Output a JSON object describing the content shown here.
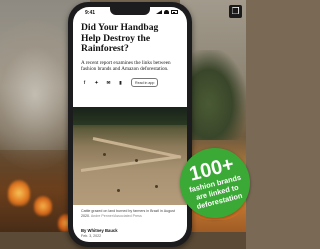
{
  "phone": {
    "status_time": "9:41",
    "article": {
      "headline": "Did Your Handbag Help Destroy the Rainforest?",
      "summary": "A recent report examines the links between fashion brands and Amazon deforestation.",
      "share_icons": [
        "facebook-icon",
        "twitter-icon",
        "email-icon",
        "bookmark-icon"
      ],
      "read_button_label": "Read in app",
      "image_caption": "Cattle grazed on land burned by farmers in Brazil in August 2020.",
      "image_credit": "Andre Penner/Associated Press",
      "byline": "By Whitney Bauck",
      "date": "Feb. 3, 2022"
    }
  },
  "badge": {
    "number": "100+",
    "text_lines": [
      "fashion brands",
      "are linked to",
      "deforestation"
    ],
    "color": "#3aa935"
  },
  "colors": {
    "phone_frame": "#1c1c1e",
    "screen": "#ffffff"
  }
}
